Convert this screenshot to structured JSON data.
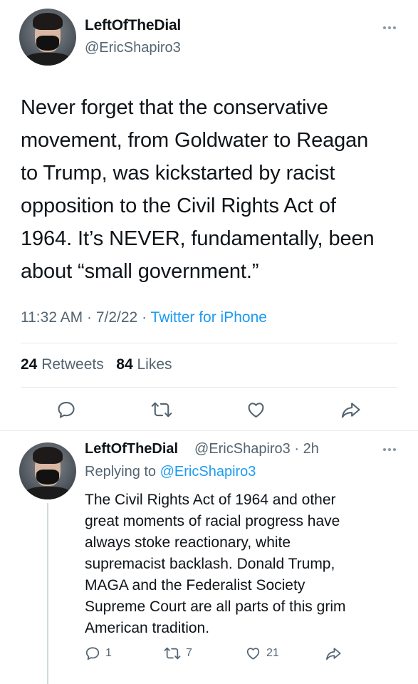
{
  "main_tweet": {
    "display_name": "LeftOfTheDial",
    "handle": "@EricShapiro3",
    "text": "Never forget that the conservative\nmovement, from Goldwater to Reagan\nto Trump, was kickstarted by racist\nopposition to the Civil Rights Act of\n1964. It’s NEVER, fundamentally, been\nabout “small government.”",
    "time": "11:32 AM",
    "date": "7/2/22",
    "source": "Twitter for iPhone",
    "retweets_count": "24",
    "retweets_label": "Retweets",
    "likes_count": "84",
    "likes_label": "Likes"
  },
  "reply_tweet": {
    "display_name": "LeftOfTheDial",
    "handle": "@EricShapiro3",
    "age": "2h",
    "replying_label": "Replying to",
    "replying_to": "@EricShapiro3",
    "text": "The Civil Rights Act of 1964 and other\ngreat moments of racial progress have\nalways stoke reactionary, white\nsupremacist backlash. Donald Trump,\nMAGA and the Federalist Society\nSupreme Court are all parts of this grim\nAmerican tradition.",
    "reply_count": "1",
    "retweet_count": "7",
    "like_count": "21"
  },
  "icons": {
    "reply": "speech-bubble-icon",
    "retweet": "retweet-arrows-icon",
    "like": "heart-outline-icon",
    "share": "share-arrow-icon",
    "more": "ellipsis-icon"
  },
  "colors": {
    "text": "#0f1419",
    "secondary": "#536471",
    "accent": "#1d9bf0",
    "divider": "#e7e9ea",
    "thread_line": "#cfd9de"
  }
}
